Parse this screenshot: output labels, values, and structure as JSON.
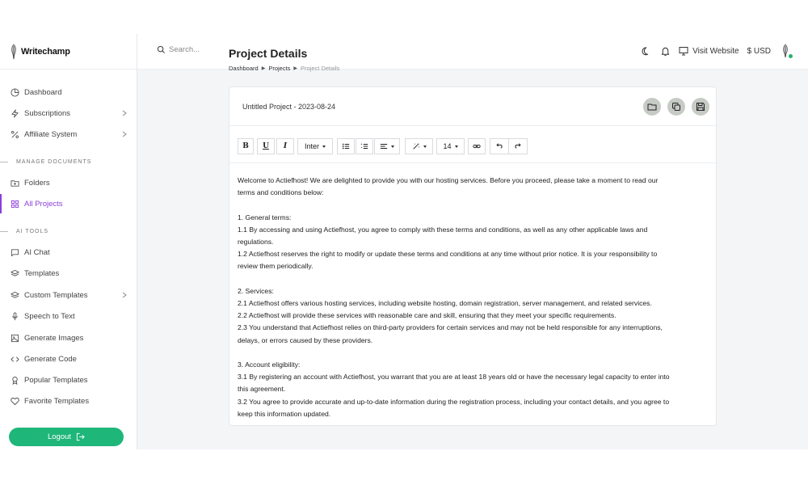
{
  "brand": {
    "name": "Writechamp"
  },
  "search": {
    "placeholder": "Search..."
  },
  "topbar": {
    "visit_label": "Visit Website",
    "currency": "$ USD"
  },
  "sidebar": {
    "items": [
      {
        "label": "Dashboard",
        "icon": "dashboard-icon"
      },
      {
        "label": "Subscriptions",
        "icon": "bolt-icon"
      },
      {
        "label": "Affiliate System",
        "icon": "percent-icon"
      }
    ],
    "section_docs": "MANAGE DOCUMENTS",
    "docs": [
      {
        "label": "Folders",
        "icon": "folder-icon"
      },
      {
        "label": "All Projects",
        "icon": "grid-icon"
      }
    ],
    "section_ai": "AI TOOLS",
    "ai": [
      {
        "label": "AI Chat",
        "icon": "chat-icon"
      },
      {
        "label": "Templates",
        "icon": "layers-icon"
      },
      {
        "label": "Custom Templates",
        "icon": "layers-icon"
      },
      {
        "label": "Speech to Text",
        "icon": "microphone-icon"
      },
      {
        "label": "Generate Images",
        "icon": "image-icon"
      },
      {
        "label": "Generate Code",
        "icon": "code-icon"
      },
      {
        "label": "Popular Templates",
        "icon": "award-icon"
      },
      {
        "label": "Favorite Templates",
        "icon": "heart-icon"
      }
    ],
    "logout": "Logout"
  },
  "page": {
    "title": "Project Details",
    "breadcrumb": [
      "Dashboard",
      "Projects",
      "Project Details"
    ]
  },
  "project": {
    "name": "Untitled Project - 2023-08-24"
  },
  "toolbar": {
    "bold": "B",
    "underline": "U",
    "italic": "I",
    "font": "Inter",
    "size": "14"
  },
  "document": {
    "lines": [
      "Welcome to Actiefhost! We are delighted to provide you with our hosting services. Before you proceed, please take a moment to read our",
      "terms and conditions below:",
      "",
      "1. General terms:",
      "1.1 By accessing and using Actiefhost, you agree to comply with these terms and conditions, as well as any other applicable laws and",
      "regulations.",
      "1.2 Actiefhost reserves the right to modify or update these terms and conditions at any time without prior notice. It is your responsibility to",
      "review them periodically.",
      "",
      "2. Services:",
      "2.1 Actiefhost offers various hosting services, including website hosting, domain registration, server management, and related services.",
      "2.2 Actiefhost will provide these services with reasonable care and skill, ensuring that they meet your specific requirements.",
      "2.3 You understand that Actiefhost relies on third-party providers for certain services and may not be held responsible for any interruptions,",
      "delays, or errors caused by these providers.",
      "",
      "3. Account eligibility:",
      "3.1 By registering an account with Actiefhost, you warrant that you are at least 18 years old or have the necessary legal capacity to enter into",
      "this agreement.",
      "3.2 You agree to provide accurate and up-to-date information during the registration process, including your contact details, and you agree to",
      "keep this information updated."
    ]
  },
  "colors": {
    "accent": "#8b3fd9",
    "logout": "#1fb67a"
  }
}
